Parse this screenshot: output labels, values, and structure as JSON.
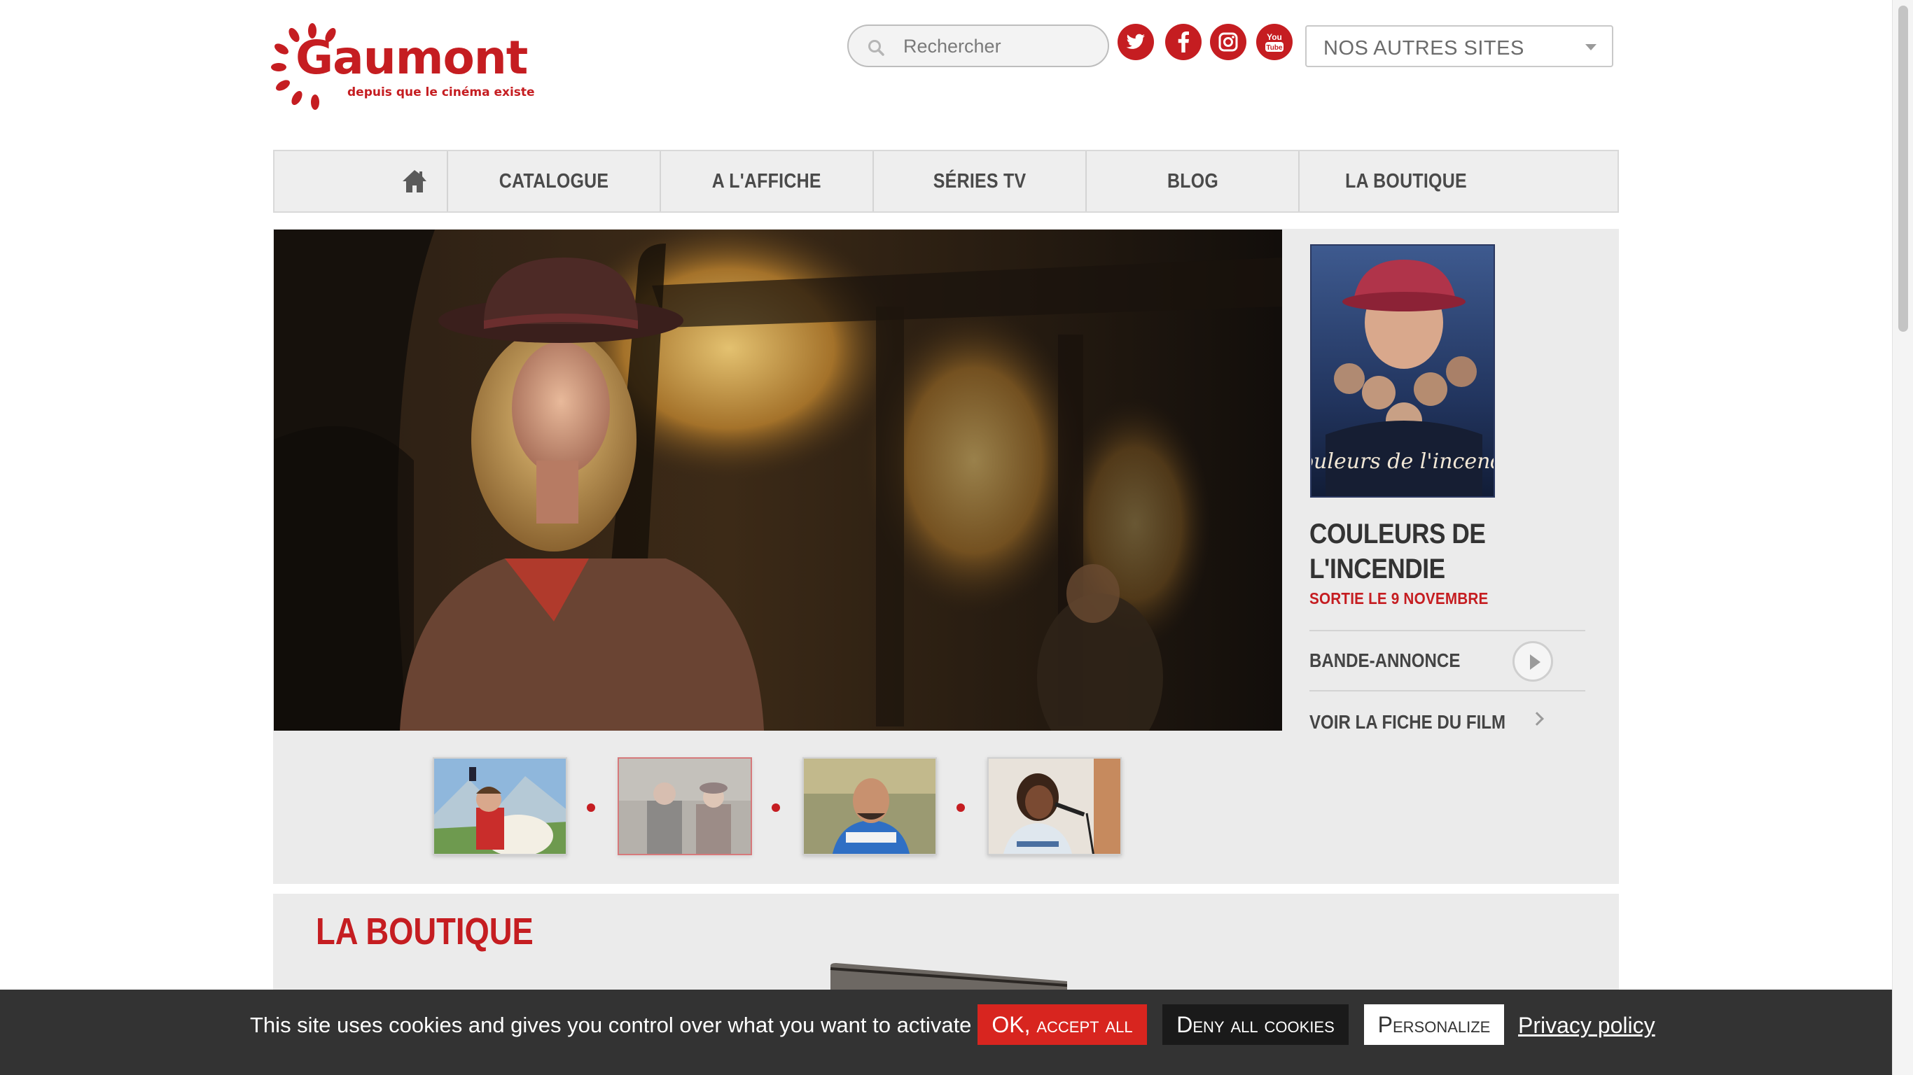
{
  "header": {
    "logo_word": "Gaumont",
    "logo_tagline": "depuis que le cinéma existe",
    "search_placeholder": "Rechercher",
    "social": [
      "twitter-icon",
      "facebook-icon",
      "instagram-icon",
      "youtube-icon"
    ],
    "youtube_icon_text_top": "You",
    "youtube_icon_text_bottom": "Tube",
    "sites_select_label": "NOS AUTRES SITES"
  },
  "nav": {
    "items": [
      "CATALOGUE",
      "A L'AFFICHE",
      "SÉRIES TV",
      "BLOG",
      "LA BOUTIQUE"
    ]
  },
  "hero": {
    "poster_title": "Couleurs de l'incendie",
    "film_title_line1": "COULEURS DE",
    "film_title_line2": "L'INCENDIE",
    "release": "SORTIE LE 9 NOVEMBRE",
    "trailer_label": "BANDE-ANNONCE",
    "fiche_label": "VOIR LA FICHE DU FILM",
    "thumbnails": [
      "thumbnail-boy-with-dog",
      "thumbnail-couple-period",
      "thumbnail-man-ski-suit",
      "thumbnail-girl-singing"
    ],
    "active_thumbnail": 1
  },
  "boutique": {
    "title": "LA BOUTIQUE"
  },
  "cookie_bar": {
    "message": "This site uses cookies and gives you control over what you want to activate",
    "accept_label": "OK, accept all",
    "deny_label": "Deny all cookies",
    "personalize_label": "Personalize",
    "privacy_label": "Privacy policy"
  },
  "colors": {
    "brand_red": "#c51d21",
    "nav_bg": "#eeeeee",
    "panel_bg": "#ebebeb",
    "cookie_bg": "#333333",
    "accept_bg": "#d8251f"
  }
}
